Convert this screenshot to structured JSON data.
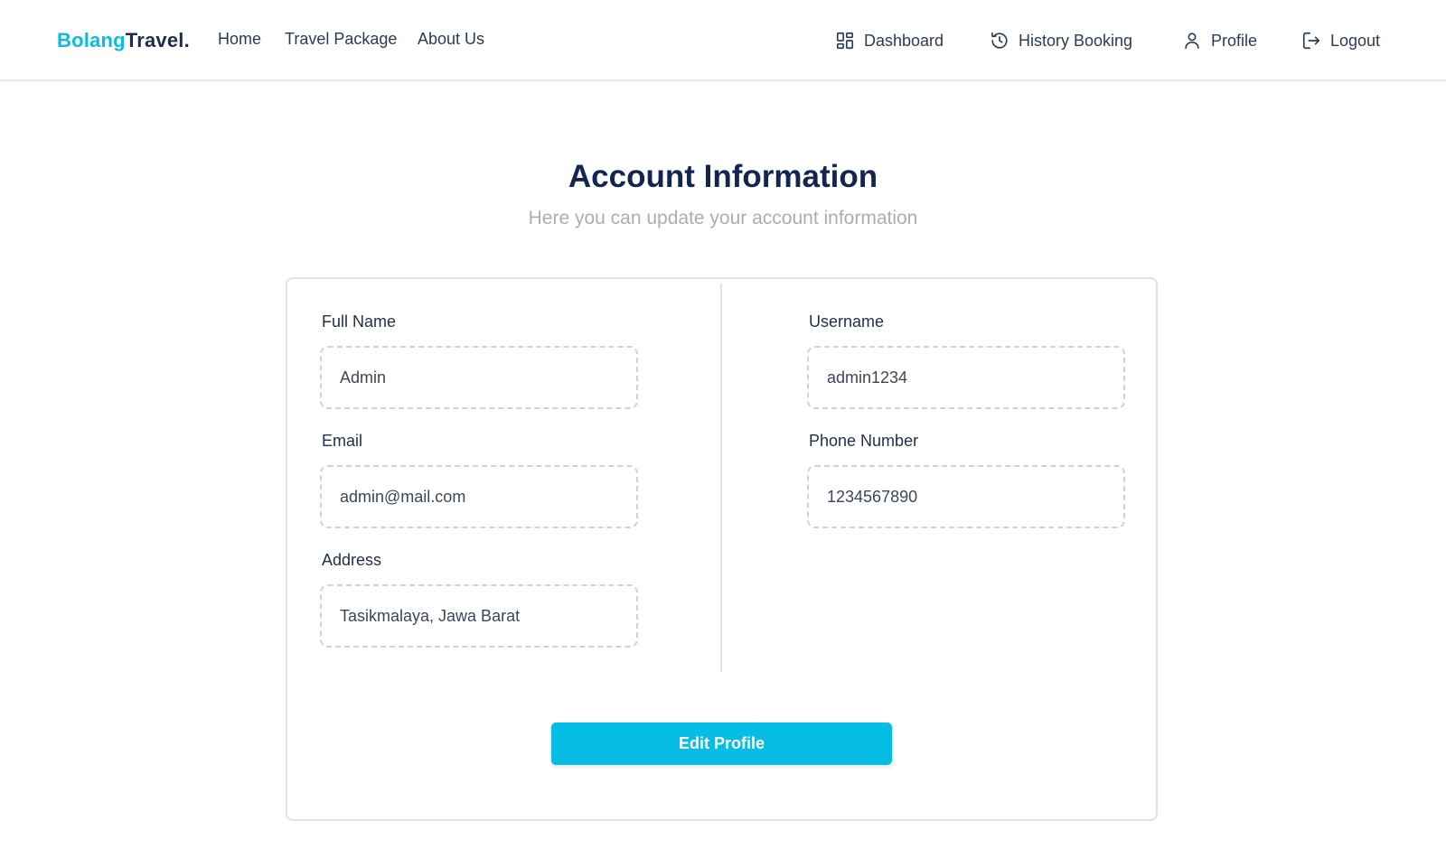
{
  "brand": {
    "part1": "Bolang",
    "part2": "Travel.",
    "accent": "#0bbbe0",
    "dark": "#1f2d4d"
  },
  "nav": {
    "left": [
      "Home",
      "Travel Package",
      "About Us"
    ],
    "right": [
      {
        "label": "Dashboard",
        "icon": "dashboard-grid-icon"
      },
      {
        "label": "History Booking",
        "icon": "history-clock-icon"
      },
      {
        "label": "Profile",
        "icon": "user-icon"
      },
      {
        "label": "Logout",
        "icon": "logout-icon"
      }
    ]
  },
  "header": {
    "title": "Account Information",
    "subtitle": "Here you can update your account information"
  },
  "form": {
    "full_name": {
      "label": "Full Name",
      "value": "Admin"
    },
    "email": {
      "label": "Email",
      "value": "admin@mail.com"
    },
    "address": {
      "label": "Address",
      "value": "Tasikmalaya, Jawa Barat"
    },
    "username": {
      "label": "Username",
      "value": "admin1234"
    },
    "phone": {
      "label": "Phone Number",
      "value": "1234567890"
    }
  },
  "button": {
    "label": "Edit Profile",
    "color": "#06bde4"
  }
}
